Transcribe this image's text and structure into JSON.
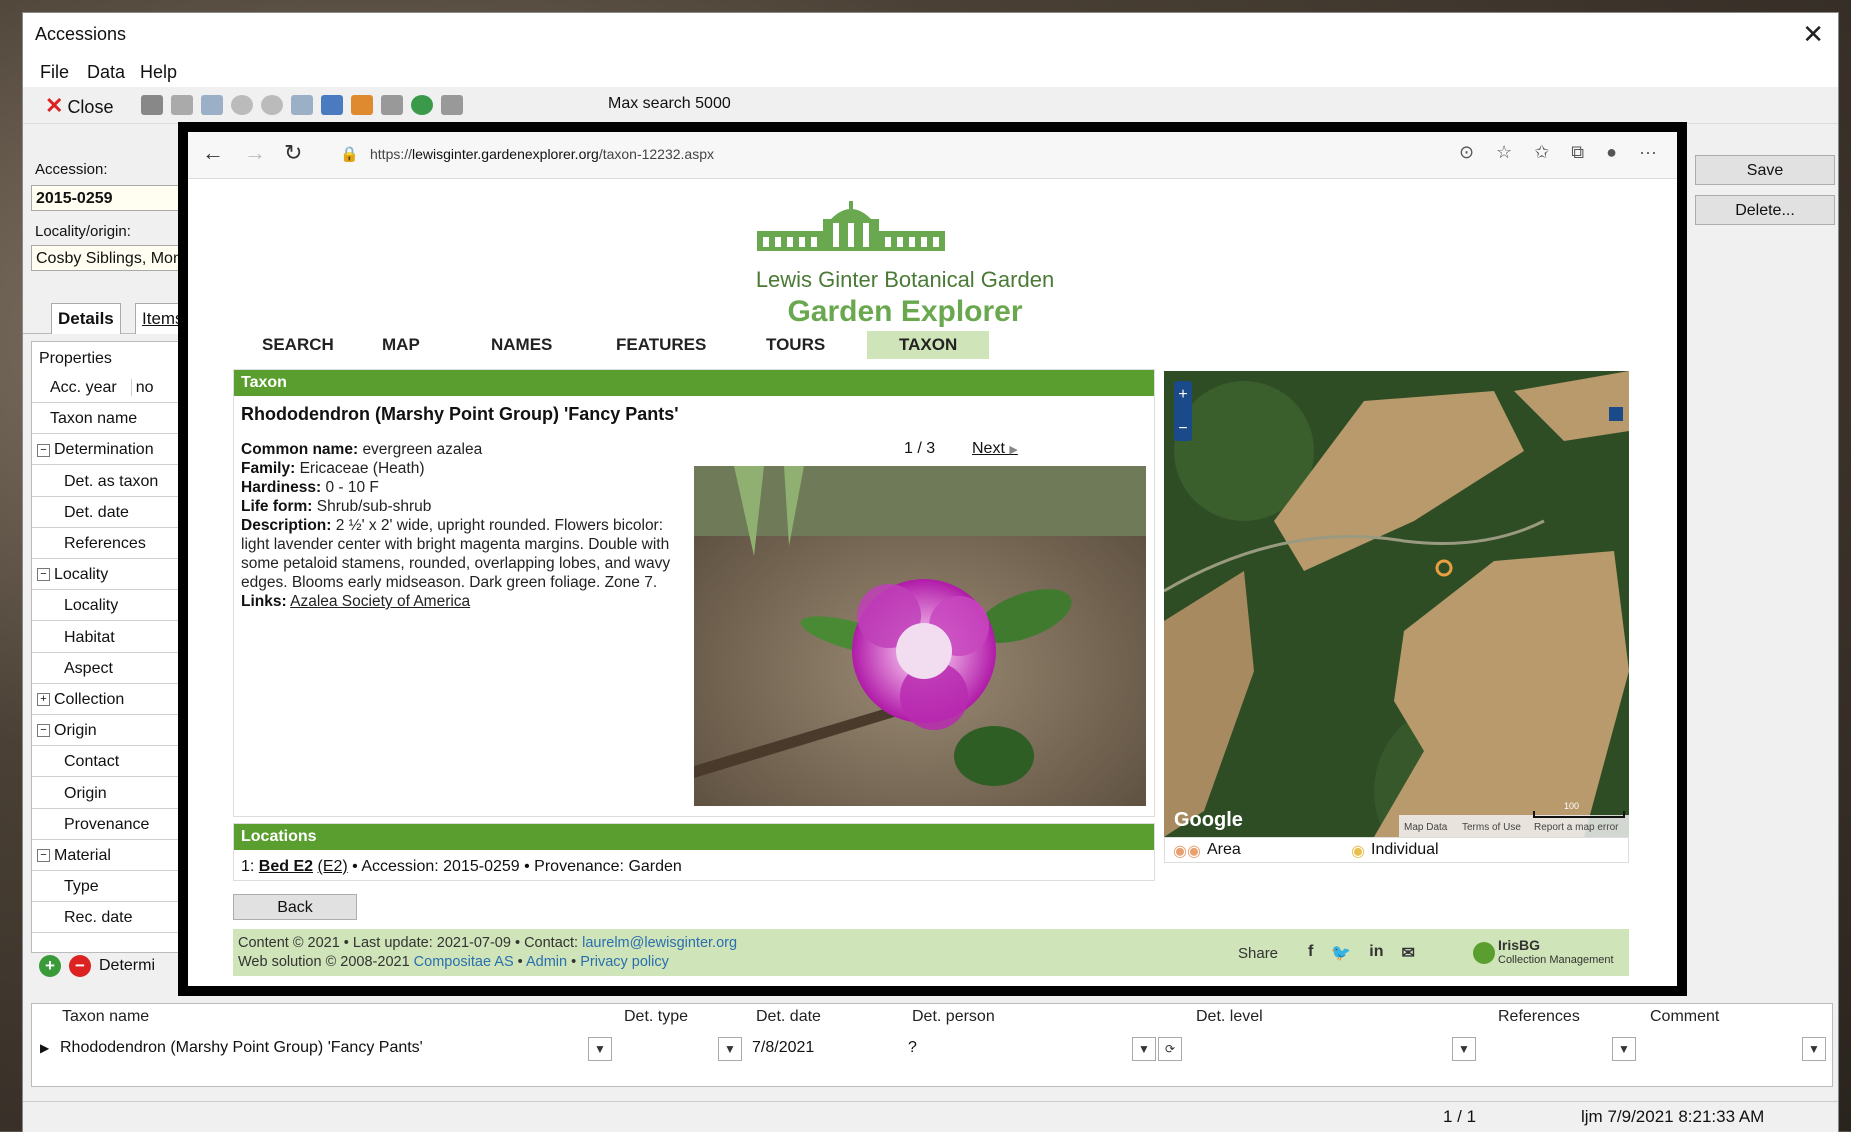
{
  "app": {
    "title": "Accessions",
    "menu": [
      "File",
      "Data",
      "Help"
    ],
    "toolbar": {
      "close_label": "Close",
      "max_search": "Max search  5000"
    },
    "accession_label": "Accession:",
    "accession_value": "2015-0259",
    "locality_label": "Locality/origin:",
    "locality_value": "Cosby Siblings, Mon",
    "save_label": "Save",
    "delete_label": "Delete...",
    "tabs": [
      "Details",
      "Items"
    ],
    "properties_header": "Properties",
    "properties": [
      {
        "label": "Acc. year",
        "value": "no",
        "indent": 1,
        "toggle": ""
      },
      {
        "label": "Taxon name",
        "value": "",
        "indent": 1,
        "toggle": ""
      },
      {
        "label": "Determination",
        "value": "",
        "indent": 0,
        "toggle": "−"
      },
      {
        "label": "Det. as taxon",
        "value": "",
        "indent": 2,
        "toggle": ""
      },
      {
        "label": "Det. date",
        "value": "",
        "indent": 2,
        "toggle": ""
      },
      {
        "label": "References",
        "value": "",
        "indent": 2,
        "toggle": ""
      },
      {
        "label": "Locality",
        "value": "",
        "indent": 0,
        "toggle": "−"
      },
      {
        "label": "Locality",
        "value": "",
        "indent": 2,
        "toggle": ""
      },
      {
        "label": "Habitat",
        "value": "",
        "indent": 2,
        "toggle": ""
      },
      {
        "label": "Aspect",
        "value": "",
        "indent": 2,
        "toggle": ""
      },
      {
        "label": "Collection",
        "value": "",
        "indent": 0,
        "toggle": "+"
      },
      {
        "label": "Origin",
        "value": "",
        "indent": 0,
        "toggle": "−"
      },
      {
        "label": "Contact",
        "value": "",
        "indent": 2,
        "toggle": ""
      },
      {
        "label": "Origin",
        "value": "",
        "indent": 2,
        "toggle": ""
      },
      {
        "label": "Provenance",
        "value": "",
        "indent": 2,
        "toggle": ""
      },
      {
        "label": "Material",
        "value": "",
        "indent": 0,
        "toggle": "−"
      },
      {
        "label": "Type",
        "value": "",
        "indent": 2,
        "toggle": ""
      },
      {
        "label": "Rec. date",
        "value": "",
        "indent": 2,
        "toggle": ""
      }
    ],
    "determinations_label": "Determi",
    "grid": {
      "headers": [
        "Taxon name",
        "Det. type",
        "Det. date",
        "Det. person",
        "Det. level",
        "References",
        "Comment"
      ],
      "row": [
        "Rhododendron (Marshy Point Group) 'Fancy Pants'",
        "",
        "7/8/2021",
        "?",
        "",
        "",
        ""
      ]
    },
    "status": {
      "record": "1 / 1",
      "user_time": "ljm 7/9/2021 8:21:33 AM"
    }
  },
  "browser": {
    "url_scheme": "https://",
    "url_host": "lewisginter.gardenexplorer.org",
    "url_path": "/taxon-12232.aspx"
  },
  "site": {
    "title1": "Lewis Ginter Botanical Garden",
    "title2": "Garden Explorer",
    "nav": [
      "SEARCH",
      "MAP",
      "NAMES",
      "FEATURES",
      "TOURS",
      "TAXON"
    ],
    "active_nav": "TAXON",
    "taxon_header": "Taxon",
    "taxon_name": "Rhododendron (Marshy Point Group) 'Fancy Pants'",
    "pager": "1 / 3",
    "next": "Next",
    "common_name_label": "Common name:",
    "common_name": "evergreen azalea",
    "family_label": "Family:",
    "family": "Ericaceae (Heath)",
    "hardiness_label": "Hardiness:",
    "hardiness": "0 - 10 F",
    "life_form_label": "Life form:",
    "life_form": "Shrub/sub-shrub",
    "description_label": "Description:",
    "description": "2 ½' x 2' wide, upright rounded. Flowers bicolor: light lavender center with bright magenta margins. Double with some petaloid stamens, rounded, overlapping lobes, and wavy edges. Blooms early midseason. Dark green foliage. Zone 7.",
    "links_label": "Links:",
    "link_text": "Azalea Society of America",
    "locations_header": "Locations",
    "location_index": "1:",
    "location_bed": "Bed E2",
    "location_code": "(E2)",
    "location_rest": " • Accession: 2015-0259 • Provenance: Garden",
    "back": "Back",
    "map_google": "Google",
    "map_attrib": [
      "Map Data",
      "Terms of Use",
      "Report a map error"
    ],
    "map_scale": "100",
    "legend_area": "Area",
    "legend_individual": "Individual",
    "footer_line1_prefix": "Content © 2021 • Last update: 2021-07-09 • Contact: ",
    "footer_email": "laurelm@lewisginter.org",
    "footer_line2_prefix": "Web solution © 2008-2021 ",
    "footer_compositae": "Compositae AS",
    "footer_admin": "Admin",
    "footer_privacy": "Privacy policy",
    "share_label": "Share",
    "irisbg_name": "IrisBG",
    "irisbg_sub": "Collection Management"
  }
}
